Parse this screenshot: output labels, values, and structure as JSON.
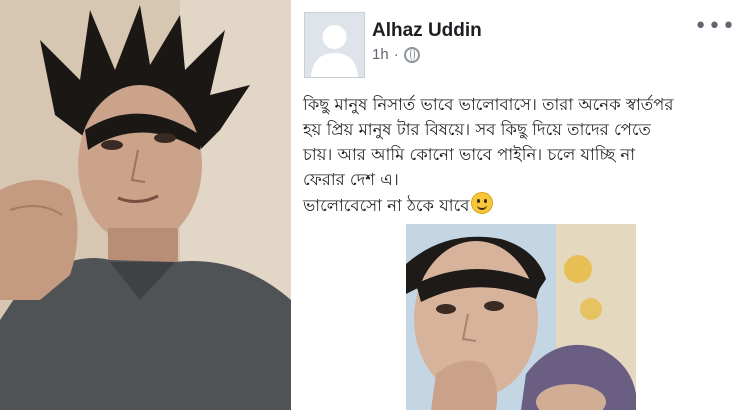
{
  "post": {
    "author": "Alhaz Uddin",
    "time": "1h",
    "separator": "·",
    "privacy_icon": "globe-icon",
    "more_label": "•••",
    "lines": [
      "কিছু মানুষ নিসার্ত ভাবে ভালোবাসে। তারা অনেক স্বার্তপর",
      "হয় প্রিয় মানুষ টার বিষয়ে। সব কিছু দিয়ে তাদের পেতে",
      "চায়। আর আমি কোনো ভাবে পাইনি। চলে যাচ্ছি না",
      "ফেরার দেশ এ।",
      " ভালোবেসো না ঠকে যাবে"
    ],
    "emoji": "smiling-face-emoji"
  },
  "colors": {
    "author_text": "#1c1e21",
    "meta_text": "#606770",
    "background": "#ffffff"
  }
}
